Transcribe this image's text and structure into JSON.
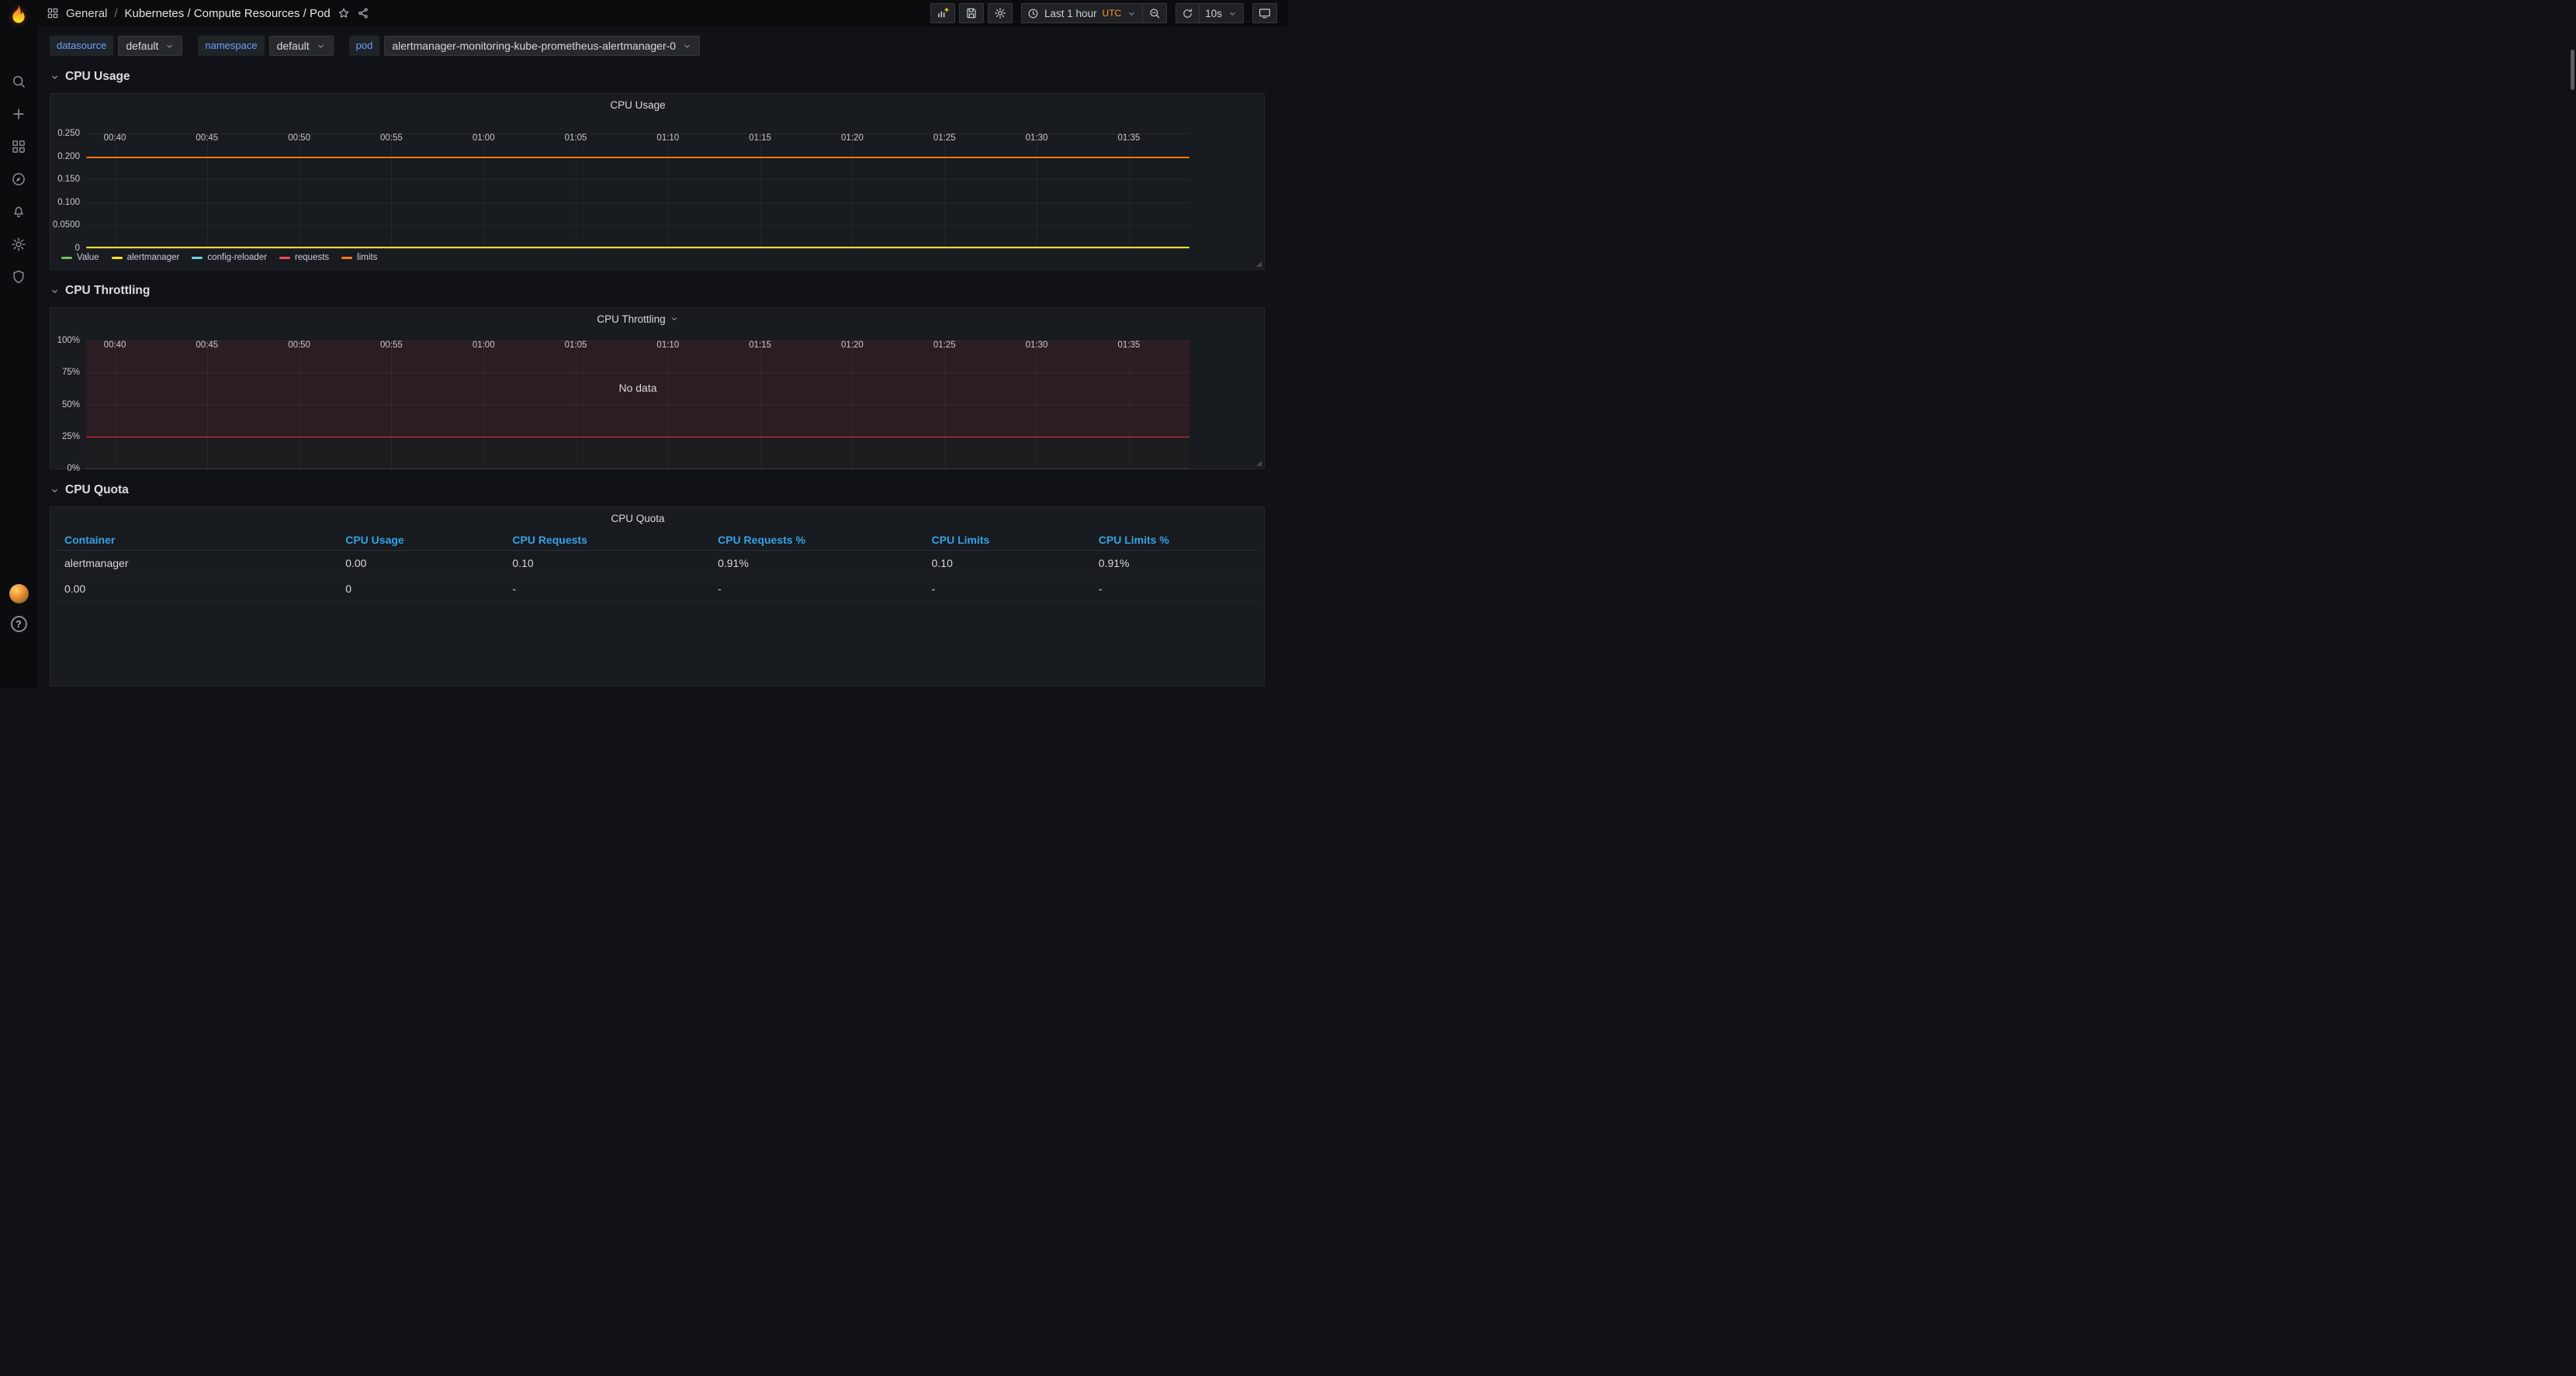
{
  "nav": {
    "breadcrumb_root": "General",
    "breadcrumb_separator": "/",
    "breadcrumb_title": "Kubernetes / Compute Resources / Pod",
    "time_range_label": "Last 1 hour",
    "timezone": "UTC",
    "refresh_interval": "10s"
  },
  "sidebar": {
    "items": [
      {
        "icon": "search",
        "name": "search"
      },
      {
        "icon": "plus",
        "name": "create"
      },
      {
        "icon": "apps",
        "name": "dashboards"
      },
      {
        "icon": "compass",
        "name": "explore"
      },
      {
        "icon": "bell",
        "name": "alerting"
      },
      {
        "icon": "gear",
        "name": "configuration"
      },
      {
        "icon": "shield",
        "name": "server-admin"
      }
    ],
    "help_label": "?"
  },
  "icons": [
    "grafana-logo",
    "search",
    "plus",
    "dashboards-grid",
    "explore-compass",
    "alerting-bell",
    "settings-gear",
    "admin-shield",
    "user-avatar",
    "help-question",
    "apps-grid",
    "star",
    "share",
    "add-panel",
    "save",
    "gear",
    "clock",
    "zoom-out",
    "refresh",
    "caret-down",
    "kiosk-tv"
  ],
  "variables": [
    {
      "label": "datasource",
      "value": "default"
    },
    {
      "label": "namespace",
      "value": "default"
    },
    {
      "label": "pod",
      "value": "alertmanager-monitoring-kube-prometheus-alertmanager-0"
    }
  ],
  "row_headers": [
    "CPU Usage",
    "CPU Throttling",
    "CPU Quota"
  ],
  "colors": {
    "page_bg": "#111217",
    "panel_bg": "#181b1f",
    "nav_bg": "#0b0c0e",
    "link_blue": "#33a2e5",
    "variable_label_blue": "#6e9fff",
    "timezone_orange": "#ff9830",
    "threshold_red": "#e02f44"
  },
  "chart_data": [
    {
      "type": "line",
      "title": "CPU Usage",
      "x": [
        "00:40",
        "00:45",
        "00:50",
        "00:55",
        "01:00",
        "01:05",
        "01:10",
        "01:15",
        "01:20",
        "01:25",
        "01:30",
        "01:35"
      ],
      "ylim": [
        0,
        0.25
      ],
      "y_ticks": [
        "0",
        "0.0500",
        "0.100",
        "0.150",
        "0.200",
        "0.250"
      ],
      "legend_position": "bottom",
      "series": [
        {
          "name": "Value",
          "color": "#73bf69",
          "value": null
        },
        {
          "name": "alertmanager",
          "color": "#fade2a",
          "value": 0.003
        },
        {
          "name": "config-reloader",
          "color": "#6ed0e0",
          "value": null
        },
        {
          "name": "requests",
          "color": "#f2495c",
          "value": null
        },
        {
          "name": "limits",
          "color": "#ff780a",
          "value": 0.2
        }
      ]
    },
    {
      "type": "line",
      "title": "CPU Throttling",
      "x": [
        "00:40",
        "00:45",
        "00:50",
        "00:55",
        "01:00",
        "01:05",
        "01:10",
        "01:15",
        "01:20",
        "01:25",
        "01:30",
        "01:35"
      ],
      "ylim": [
        0,
        100
      ],
      "y_ticks": [
        "0%",
        "25%",
        "50%",
        "75%",
        "100%"
      ],
      "threshold": {
        "value": 25,
        "color": "#e02f44"
      },
      "no_data": "No data"
    },
    {
      "type": "table",
      "title": "CPU Quota",
      "columns": [
        "Container",
        "CPU Usage",
        "CPU Requests",
        "CPU Requests %",
        "CPU Limits",
        "CPU Limits %"
      ],
      "rows": [
        [
          "alertmanager",
          "0.00",
          "0.10",
          "0.91%",
          "0.10",
          "0.91%"
        ],
        [
          "0.00",
          "0",
          "-",
          "-",
          "-",
          "-"
        ]
      ]
    }
  ]
}
